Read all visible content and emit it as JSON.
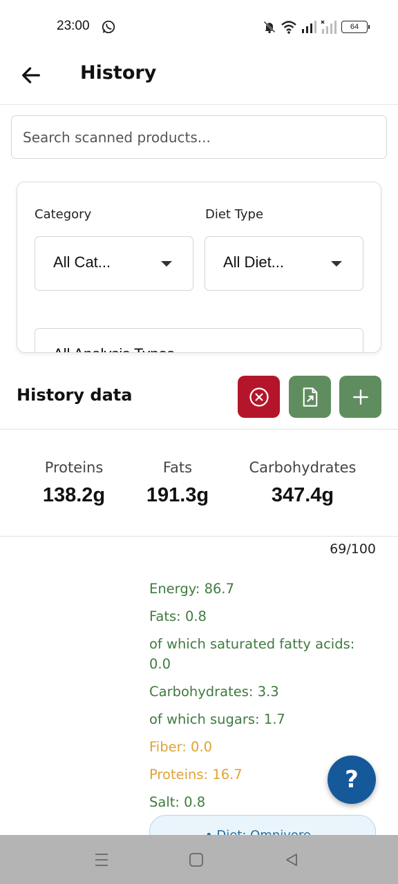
{
  "status_bar": {
    "time": "23:00",
    "battery": "64",
    "icons": [
      "whatsapp-icon",
      "bell-off-icon",
      "wifi-icon",
      "signal-icon",
      "signal-icon-2",
      "battery-icon"
    ]
  },
  "app_bar": {
    "title": "History",
    "back_icon": "arrow-left-icon"
  },
  "search": {
    "placeholder": "Search scanned products..."
  },
  "filters": {
    "category_label": "Category",
    "category_value": "All Cat...",
    "diet_label": "Diet Type",
    "diet_value": "All Diet...",
    "analysis_value": "All Analysis Types"
  },
  "history_data": {
    "title": "History data",
    "actions": [
      {
        "name": "clear",
        "icon": "close-circle-icon",
        "color": "#b5152b"
      },
      {
        "name": "export",
        "icon": "file-export-icon",
        "color": "#5f8d5f"
      },
      {
        "name": "add",
        "icon": "plus-icon",
        "color": "#5f8d5f"
      }
    ]
  },
  "macros": [
    {
      "label": "Proteins",
      "value": "138.2g"
    },
    {
      "label": "Fats",
      "value": "191.3g"
    },
    {
      "label": "Carbohydrates",
      "value": "347.4g"
    }
  ],
  "item": {
    "score": "69/100",
    "nutrients": [
      {
        "text": "Energy: 86.7",
        "status": "green"
      },
      {
        "text": "Fats: 0.8",
        "status": "green"
      },
      {
        "text": "of which saturated fatty acids: 0.0",
        "status": "green"
      },
      {
        "text": "Carbohydrates: 3.3",
        "status": "green"
      },
      {
        "text": "of which sugars: 1.7",
        "status": "green"
      },
      {
        "text": "Fiber: 0.0",
        "status": "orange"
      },
      {
        "text": "Proteins: 16.7",
        "status": "orange"
      },
      {
        "text": "Salt: 0.8",
        "status": "green"
      }
    ],
    "diet_chip": "• Diet: Omnivore"
  },
  "help_button": "?",
  "colors": {
    "green_text": "#3f7a3f",
    "orange_text": "#e0a232",
    "danger": "#b5152b",
    "primary_green": "#5f8d5f",
    "fab": "#16599a"
  }
}
